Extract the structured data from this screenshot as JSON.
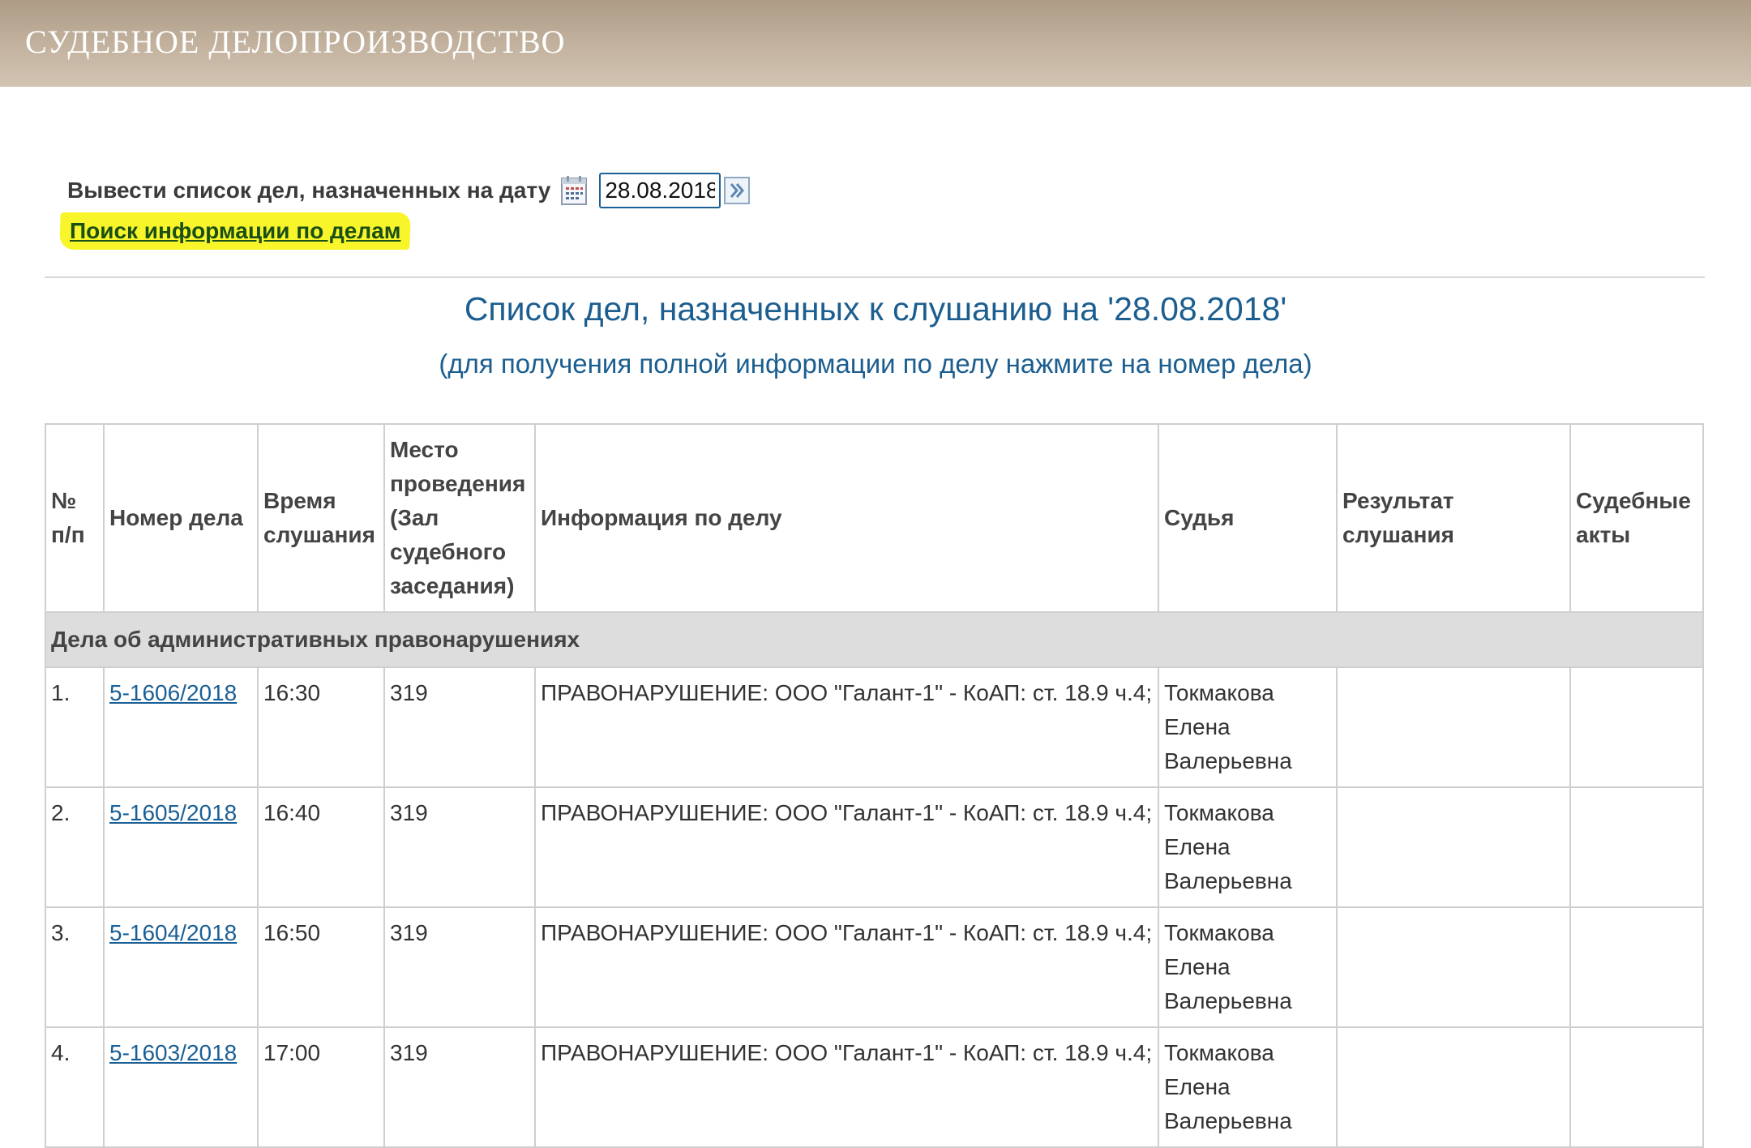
{
  "header": {
    "title": "СУДЕБНОЕ ДЕЛОПРОИЗВОДСТВО"
  },
  "date_filter": {
    "label": "Вывести список дел, назначенных на дату",
    "value": "28.08.2018",
    "calendar_icon": "calendar-icon",
    "go_icon": "arrow-right-icon"
  },
  "search_link": "Поиск информации по делам",
  "list": {
    "title": "Список дел, назначенных к слушанию на '28.08.2018'",
    "subtitle": "(для получения полной информации по делу нажмите на номер дела)"
  },
  "table": {
    "columns": [
      "№ п/п",
      "Номер дела",
      "Время слушания",
      "Место проведения (Зал судебного заседания)",
      "Информация по делу",
      "Судья",
      "Результат слушания",
      "Судебные акты"
    ],
    "category": "Дела об административных правонарушениях",
    "rows": [
      {
        "num": "1.",
        "case": "5-1606/2018",
        "time": "16:30",
        "room": "319",
        "info": "ПРАВОНАРУШЕНИЕ: ООО \"Галант-1\" - КоАП: ст. 18.9 ч.4;",
        "judge": "Токмакова Елена Валерьевна",
        "result": "",
        "acts": ""
      },
      {
        "num": "2.",
        "case": "5-1605/2018",
        "time": "16:40",
        "room": "319",
        "info": "ПРАВОНАРУШЕНИЕ: ООО \"Галант-1\" - КоАП: ст. 18.9 ч.4;",
        "judge": "Токмакова Елена Валерьевна",
        "result": "",
        "acts": ""
      },
      {
        "num": "3.",
        "case": "5-1604/2018",
        "time": "16:50",
        "room": "319",
        "info": "ПРАВОНАРУШЕНИЕ: ООО \"Галант-1\" - КоАП: ст. 18.9 ч.4;",
        "judge": "Токмакова Елена Валерьевна",
        "result": "",
        "acts": ""
      },
      {
        "num": "4.",
        "case": "5-1603/2018",
        "time": "17:00",
        "room": "319",
        "info": "ПРАВОНАРУШЕНИЕ: ООО \"Галант-1\" - КоАП: ст. 18.9 ч.4;",
        "judge": "Токмакова Елена Валерьевна",
        "result": "",
        "acts": ""
      }
    ]
  },
  "colors": {
    "header_bar": "#b8a690",
    "title_blue": "#1b5e8f",
    "link_blue": "#1a5f95",
    "highlight": "#f8f52a",
    "category_bg": "#dddddd"
  }
}
